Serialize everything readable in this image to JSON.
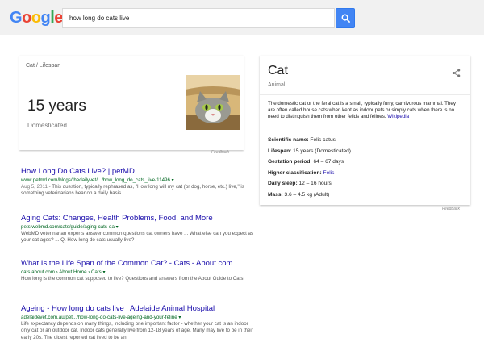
{
  "logo": {
    "letters": [
      "G",
      "o",
      "o",
      "g",
      "l",
      "e"
    ],
    "colors": [
      "#4285f4",
      "#ea4335",
      "#fbbc05",
      "#4285f4",
      "#34a853",
      "#ea4335"
    ]
  },
  "search": {
    "query": "how long do cats live",
    "button_icon": "search-icon",
    "button_color": "#4285f4"
  },
  "answer": {
    "breadcrumb": "Cat / Lifespan",
    "value": "15 years",
    "subtitle": "Domesticated",
    "image_source": "Feedback"
  },
  "results": [
    {
      "title": "How Long Do Cats Live? | petMD",
      "url": "www.petmd.com/blogs/thedailyvet/.../how_long_do_cats_live-11496 ▾",
      "date": "Aug 5, 2011 -",
      "snippet": " This question, typically rephrased as, \"How long will my cat (or dog, horse, etc.) live,\" is something veterinarians hear on a daily basis."
    },
    {
      "title": "Aging Cats: Changes, Health Problems, Food, and More",
      "url": "pets.webmd.com/cats/guide/aging-cats-qa ▾",
      "date": "",
      "snippet": "WebMD veterinarian experts answer common questions cat owners have ... What else can you expect as your cat ages? ... Q. How long do cats usually live?"
    },
    {
      "title": "What Is the Life Span of the Common Cat? - Cats - About.com",
      "url": "cats.about.com › About Home › Cats ▾",
      "date": "",
      "snippet": "How long is the common cat supposed to live? Questions and answers from the About Guide to Cats."
    },
    {
      "title": "Ageing - How long do cats live | Adelaide Animal Hospital",
      "url": "adelaidevet.com.au/pet.../how-long-do-cats-live-ageing-and-your-feline ▾",
      "date": "",
      "snippet": "Life expectancy depends on many things, including one important factor - whether your cat is an indoor only cat or an outdoor cat. Indoor cats generally live from 12-18 years of age. Many may live to be in their early 20s. The oldest reported cat lived to be an"
    }
  ],
  "panel": {
    "title": "Cat",
    "subtitle": "Animal",
    "share_icon": "share-icon",
    "description": "The domestic cat or the feral cat is a small, typically furry, carnivorous mammal. They are often called house cats when kept as indoor pets or simply cats when there is no need to distinguish them from other felids and felines.",
    "description_link": "Wikipedia",
    "facts": [
      {
        "label": "Scientific name:",
        "value": "Felis catus",
        "link": ""
      },
      {
        "label": "Lifespan:",
        "value": "15 years (Domesticated)",
        "link": ""
      },
      {
        "label": "Gestation period:",
        "value": "64 – 67 days",
        "link": ""
      },
      {
        "label": "Higher classification:",
        "value": "",
        "link": "Felis"
      },
      {
        "label": "Daily sleep:",
        "value": "12 – 16 hours",
        "link": ""
      },
      {
        "label": "Mass:",
        "value": "3.6 – 4.5 kg (Adult)",
        "link": ""
      }
    ],
    "feedback": "Feedback"
  }
}
